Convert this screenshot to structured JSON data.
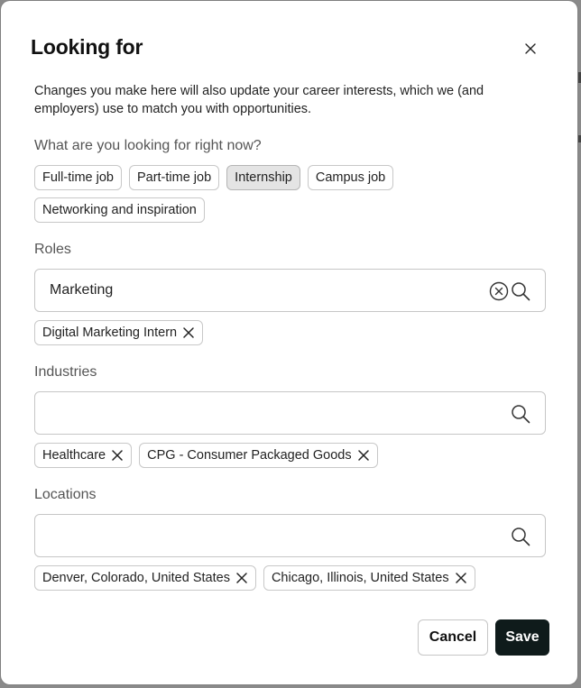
{
  "dialog": {
    "title": "Looking for",
    "intro": "Changes you make here will also update your career interests, which we (and employers) use to match you with opportunities."
  },
  "looking_for": {
    "label": "What are you looking for right now?",
    "options": [
      {
        "label": "Full-time job",
        "selected": false
      },
      {
        "label": "Part-time job",
        "selected": false
      },
      {
        "label": "Internship",
        "selected": true
      },
      {
        "label": "Campus job",
        "selected": false
      },
      {
        "label": "Networking and inspiration",
        "selected": false
      }
    ]
  },
  "roles": {
    "label": "Roles",
    "input_value": "Marketing",
    "input_placeholder": "",
    "tags": [
      "Digital Marketing Intern"
    ]
  },
  "industries": {
    "label": "Industries",
    "input_value": "",
    "input_placeholder": "",
    "tags": [
      "Healthcare",
      "CPG - Consumer Packaged Goods"
    ]
  },
  "locations": {
    "label": "Locations",
    "input_value": "",
    "input_placeholder": "",
    "tags": [
      "Denver, Colorado, United States",
      "Chicago, Illinois, United States"
    ]
  },
  "footer": {
    "cancel_label": "Cancel",
    "save_label": "Save"
  },
  "colors": {
    "primary_button": "#0f1b1b",
    "selected_chip": "#e4e4e4"
  },
  "icons": {
    "close": "close-icon",
    "clear": "clear-circle-icon",
    "search": "search-icon",
    "remove": "remove-x-icon"
  }
}
